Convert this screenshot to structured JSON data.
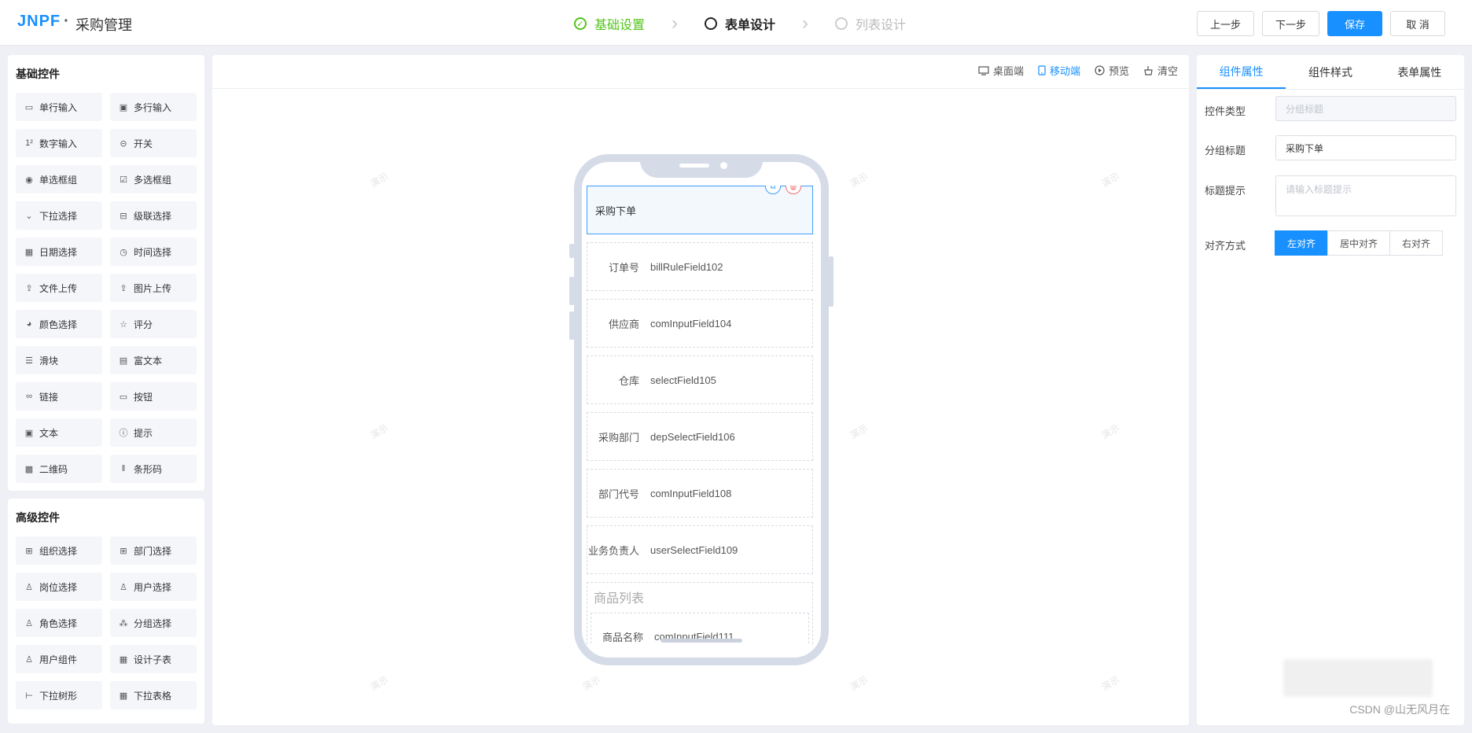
{
  "header": {
    "logo": "JNPF",
    "logo_sep": "·",
    "title": "采购管理",
    "steps": [
      {
        "label": "基础设置",
        "state": "done"
      },
      {
        "label": "表单设计",
        "state": "active"
      },
      {
        "label": "列表设计",
        "state": "todo"
      }
    ],
    "buttons": {
      "prev": "上一步",
      "next": "下一步",
      "save": "保存",
      "cancel": "取 消"
    }
  },
  "left": {
    "basic_title": "基础控件",
    "basic": [
      {
        "label": "单行输入",
        "icon": "input-icon"
      },
      {
        "label": "多行输入",
        "icon": "textarea-icon"
      },
      {
        "label": "数字输入",
        "icon": "number-icon"
      },
      {
        "label": "开关",
        "icon": "switch-icon"
      },
      {
        "label": "单选框组",
        "icon": "radio-icon"
      },
      {
        "label": "多选框组",
        "icon": "checkbox-icon"
      },
      {
        "label": "下拉选择",
        "icon": "select-icon"
      },
      {
        "label": "级联选择",
        "icon": "cascader-icon"
      },
      {
        "label": "日期选择",
        "icon": "date-icon"
      },
      {
        "label": "时间选择",
        "icon": "clock-icon"
      },
      {
        "label": "文件上传",
        "icon": "upload-icon"
      },
      {
        "label": "图片上传",
        "icon": "image-upload-icon"
      },
      {
        "label": "颜色选择",
        "icon": "palette-icon"
      },
      {
        "label": "评分",
        "icon": "star-icon"
      },
      {
        "label": "滑块",
        "icon": "slider-icon"
      },
      {
        "label": "富文本",
        "icon": "richtext-icon"
      },
      {
        "label": "链接",
        "icon": "link-icon"
      },
      {
        "label": "按钮",
        "icon": "button-icon"
      },
      {
        "label": "文本",
        "icon": "text-icon"
      },
      {
        "label": "提示",
        "icon": "info-icon"
      },
      {
        "label": "二维码",
        "icon": "qrcode-icon"
      },
      {
        "label": "条形码",
        "icon": "barcode-icon"
      }
    ],
    "adv_title": "高级控件",
    "advanced": [
      {
        "label": "组织选择",
        "icon": "org-icon"
      },
      {
        "label": "部门选择",
        "icon": "dept-icon"
      },
      {
        "label": "岗位选择",
        "icon": "position-icon"
      },
      {
        "label": "用户选择",
        "icon": "user-icon"
      },
      {
        "label": "角色选择",
        "icon": "role-icon"
      },
      {
        "label": "分组选择",
        "icon": "group-icon"
      },
      {
        "label": "用户组件",
        "icon": "user-comp-icon"
      },
      {
        "label": "设计子表",
        "icon": "table-icon"
      },
      {
        "label": "下拉树形",
        "icon": "tree-icon"
      },
      {
        "label": "下拉表格",
        "icon": "table-select-icon"
      }
    ]
  },
  "canvas": {
    "toolbar": {
      "desktop": "桌面端",
      "mobile": "移动端",
      "preview": "预览",
      "clear": "清空"
    },
    "selected_title": "采购下单",
    "fields": [
      {
        "label": "订单号",
        "value": "billRuleField102"
      },
      {
        "label": "供应商",
        "value": "comInputField104"
      },
      {
        "label": "仓库",
        "value": "selectField105"
      },
      {
        "label": "采购部门",
        "value": "depSelectField106"
      },
      {
        "label": "部门代号",
        "value": "comInputField108"
      },
      {
        "label": "业务负责人",
        "value": "userSelectField109"
      }
    ],
    "section_title": "商品列表",
    "section_field": {
      "label": "商品名称",
      "value": "comInputField111"
    },
    "watermark": "演示"
  },
  "right": {
    "tabs": [
      "组件属性",
      "组件样式",
      "表单属性"
    ],
    "type_label": "控件类型",
    "type_value": "分组标题",
    "title_label": "分组标题",
    "title_value": "采购下单",
    "tip_label": "标题提示",
    "tip_placeholder": "请输入标题提示",
    "align_label": "对齐方式",
    "align": [
      "左对齐",
      "居中对齐",
      "右对齐"
    ]
  },
  "credit": "CSDN @山无风月在",
  "colors": {
    "primary": "#1890ff",
    "done": "#52c41a",
    "danger": "#f56c6c"
  }
}
